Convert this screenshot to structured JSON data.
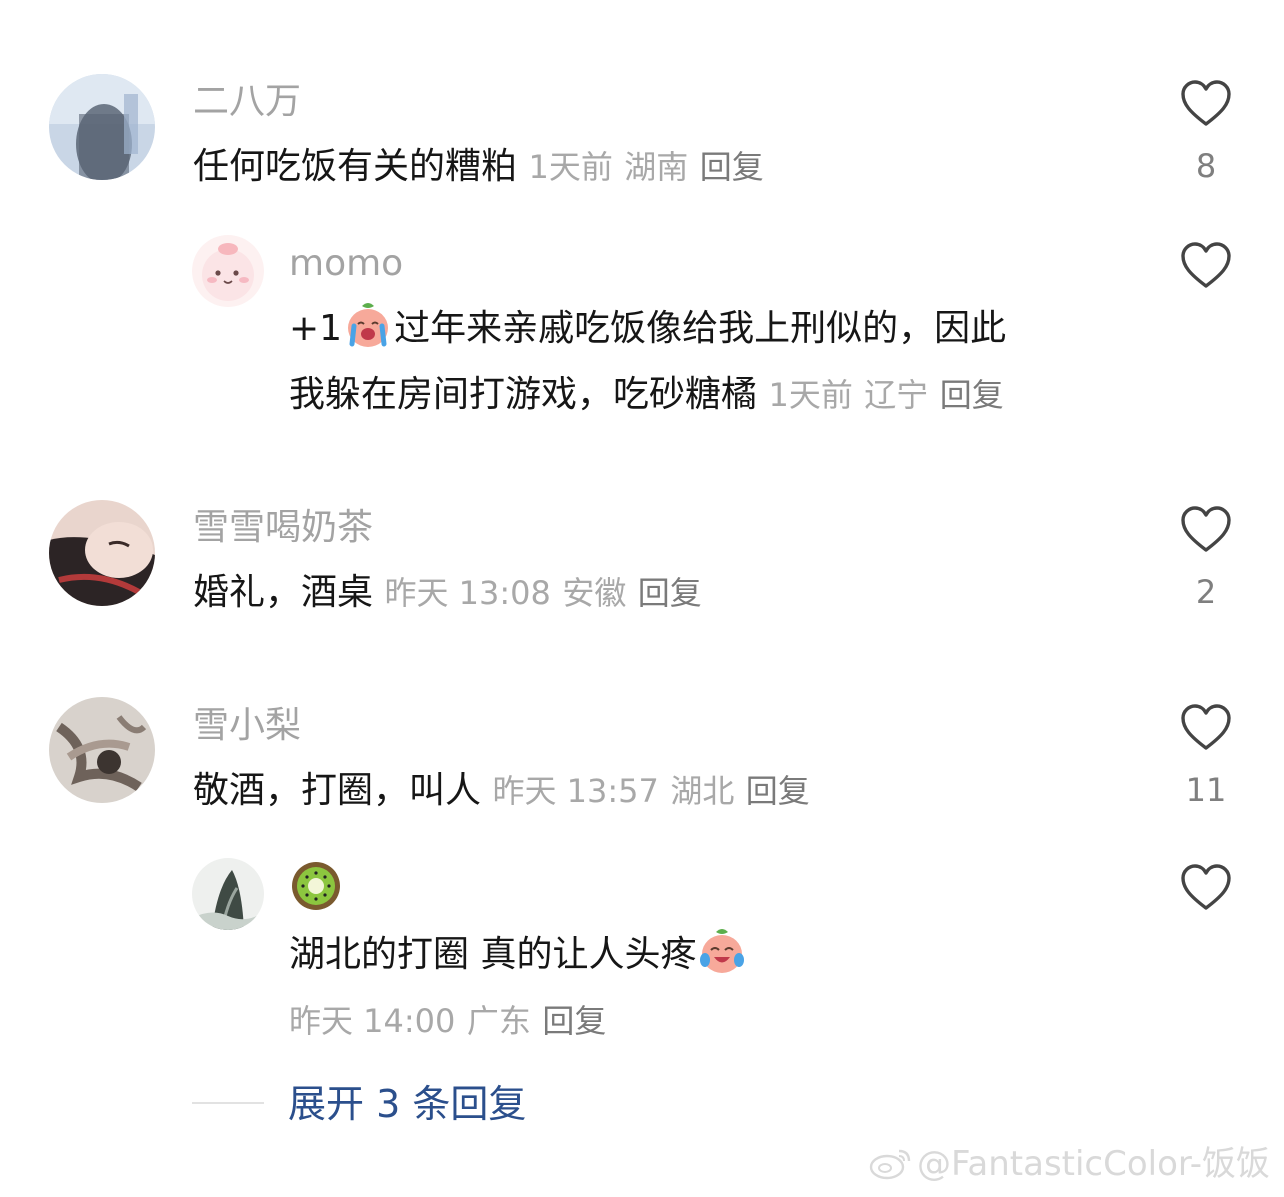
{
  "comments": [
    {
      "username": "二八万",
      "text": "任何吃饭有关的糟粕",
      "time": "1天前",
      "location": "湖南",
      "reply_label": "回复",
      "likes": "8"
    },
    {
      "username": "momo",
      "text_prefix": "+1",
      "text_line1": "过年来亲戚吃饭像给我上刑似的，因此",
      "text_line2": "我躲在房间打游戏，吃砂糖橘",
      "time": "1天前",
      "location": "辽宁",
      "reply_label": "回复",
      "likes": ""
    },
    {
      "username": "雪雪喝奶茶",
      "text": "婚礼，酒桌",
      "time": "昨天 13:08",
      "location": "安徽",
      "reply_label": "回复",
      "likes": "2"
    },
    {
      "username": "雪小梨",
      "text": "敬酒，打圈，叫人",
      "time": "昨天 13:57",
      "location": "湖北",
      "reply_label": "回复",
      "likes": "11"
    },
    {
      "username_icon": "kiwi-icon",
      "text": "湖北的打圈 真的让人头疼",
      "time": "昨天 14:00",
      "location": "广东",
      "reply_label": "回复",
      "likes": ""
    }
  ],
  "expand_replies": "展开 3 条回复",
  "watermark": "@FantasticColor-饭饭",
  "colors": {
    "username": "#a3a3a3",
    "text": "#161616",
    "meta": "#a8a8a8",
    "link": "#2b4f8c"
  }
}
